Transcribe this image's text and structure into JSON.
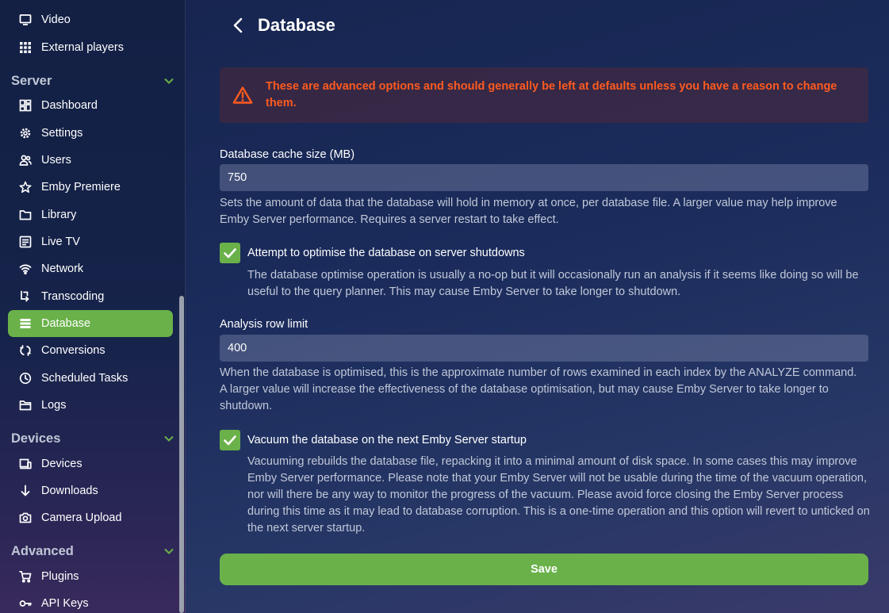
{
  "sidebar": {
    "top_items": [
      {
        "label": "Video",
        "icon": "monitor-icon"
      },
      {
        "label": "External players",
        "icon": "grid-dots-icon"
      }
    ],
    "server": {
      "header": "Server",
      "items": [
        {
          "label": "Dashboard",
          "icon": "dashboard-icon"
        },
        {
          "label": "Settings",
          "icon": "gear-icon"
        },
        {
          "label": "Users",
          "icon": "users-icon"
        },
        {
          "label": "Emby Premiere",
          "icon": "star-icon"
        },
        {
          "label": "Library",
          "icon": "folder-icon"
        },
        {
          "label": "Live TV",
          "icon": "tv-guide-icon"
        },
        {
          "label": "Network",
          "icon": "wifi-icon"
        },
        {
          "label": "Transcoding",
          "icon": "transcode-icon"
        },
        {
          "label": "Database",
          "icon": "database-icon"
        },
        {
          "label": "Conversions",
          "icon": "sync-icon"
        },
        {
          "label": "Scheduled Tasks",
          "icon": "clock-icon"
        },
        {
          "label": "Logs",
          "icon": "folder-open-icon"
        }
      ]
    },
    "devices": {
      "header": "Devices",
      "items": [
        {
          "label": "Devices",
          "icon": "devices-icon"
        },
        {
          "label": "Downloads",
          "icon": "arrow-down-icon"
        },
        {
          "label": "Camera Upload",
          "icon": "camera-icon"
        }
      ]
    },
    "advanced": {
      "header": "Advanced",
      "items": [
        {
          "label": "Plugins",
          "icon": "cart-icon"
        },
        {
          "label": "API Keys",
          "icon": "key-icon"
        }
      ]
    },
    "active_item": "Database"
  },
  "main": {
    "title": "Database",
    "warning": "These are advanced options and should generally be left at defaults unless you have a reason to change them.",
    "cache_size": {
      "label": "Database cache size (MB)",
      "value": "750",
      "help": "Sets the amount of data that the database will hold in memory at once, per database file. A larger value may help improve Emby Server performance. Requires a server restart to take effect."
    },
    "optimise": {
      "label": "Attempt to optimise the database on server shutdowns",
      "checked": true,
      "help": "The database optimise operation is usually a no-op but it will occasionally run an analysis if it seems like doing so will be useful to the query planner. This may cause Emby Server to take longer to shutdown."
    },
    "row_limit": {
      "label": "Analysis row limit",
      "value": "400",
      "help": "When the database is optimised, this is the approximate number of rows examined in each index by the ANALYZE command. A larger value will increase the effectiveness of the database optimisation, but may cause Emby Server to take longer to shutdown."
    },
    "vacuum": {
      "label": "Vacuum the database on the next Emby Server startup",
      "checked": true,
      "help": "Vacuuming rebuilds the database file, repacking it into a minimal amount of disk space. In some cases this may improve Emby Server performance. Please note that your Emby Server will not be usable during the time of the vacuum operation, nor will there be any way to monitor the progress of the vacuum. Please avoid force closing the Emby Server process during this time as it may lead to database corruption. This is a one-time operation and this option will revert to unticked on the next server startup."
    },
    "save_label": "Save"
  },
  "colors": {
    "accent": "#6ab14a",
    "warning": "#ff5a1f"
  }
}
